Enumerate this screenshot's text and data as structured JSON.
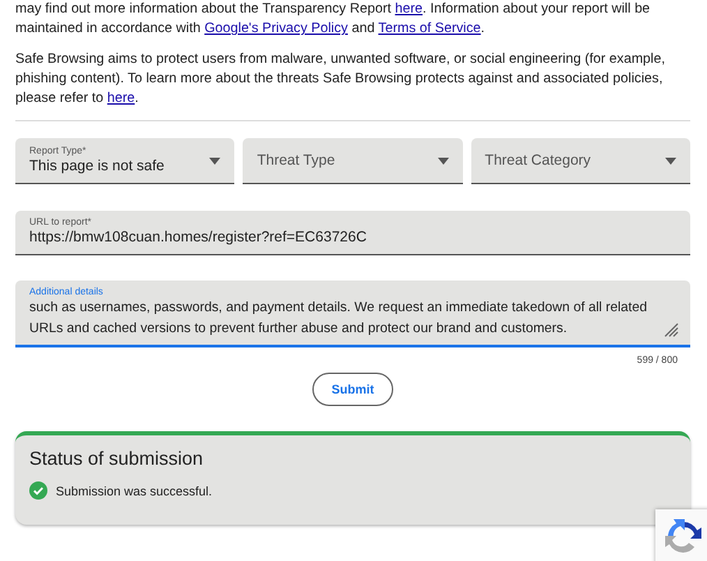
{
  "intro_paragraphs": [
    {
      "parts": [
        {
          "text": "may find out more information about the Transparency Report ",
          "link": false
        },
        {
          "text": "here",
          "link": true
        },
        {
          "text": ". Information about your report will be maintained in accordance with ",
          "link": false
        },
        {
          "text": "Google's Privacy Policy",
          "link": true
        },
        {
          "text": " and ",
          "link": false
        },
        {
          "text": "Terms of Service",
          "link": true
        },
        {
          "text": ".",
          "link": false
        }
      ]
    },
    {
      "parts": [
        {
          "text": "Safe Browsing aims to protect users from malware, unwanted software, or social engineering (for example, phishing content). To learn more about the threats Safe Browsing protects against and associated policies, please refer to ",
          "link": false
        },
        {
          "text": "here",
          "link": true
        },
        {
          "text": ".",
          "link": false
        }
      ]
    }
  ],
  "dropdowns": [
    {
      "label": "Report Type*",
      "value": "This page is not safe"
    },
    {
      "placeholder": "Threat Type"
    },
    {
      "placeholder": "Threat Category"
    }
  ],
  "url_field": {
    "label": "URL to report*",
    "value": "https://bmw108cuan.homes/register?ref=EC63726C"
  },
  "details_field": {
    "label": "Additional details",
    "focused": true,
    "value": "such as usernames, passwords, and payment details. We request an immediate takedown of all related URLs and cached versions to prevent further abuse and protect our brand and customers.",
    "counter": "599 / 800"
  },
  "submit_button": "Submit",
  "status": {
    "title": "Status of submission",
    "message": "Submission was successful.",
    "success": true
  }
}
